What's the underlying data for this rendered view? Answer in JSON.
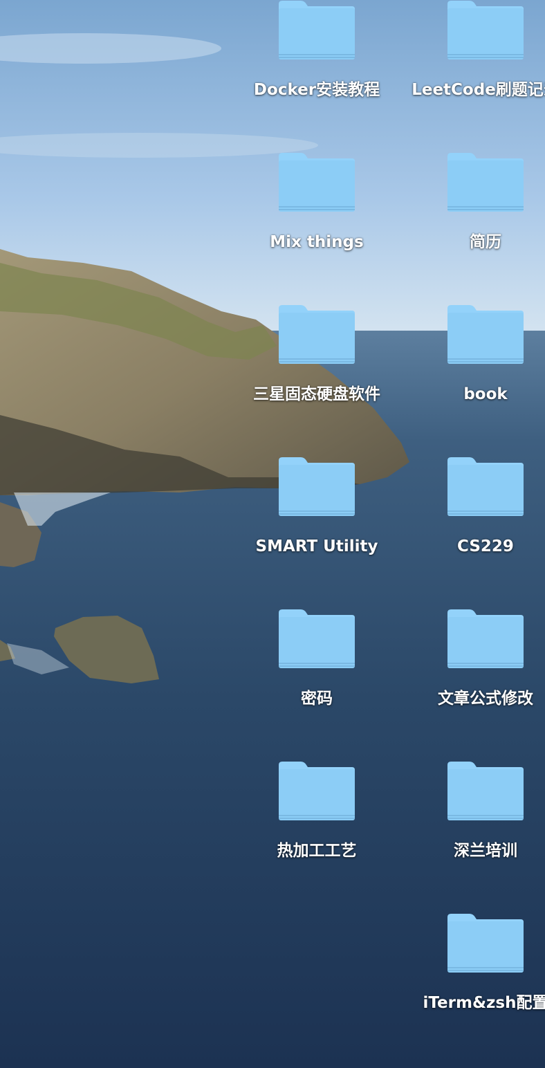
{
  "desktop": {
    "items": [
      {
        "label": "Docker安装教程",
        "icon": "folder-icon"
      },
      {
        "label": "LeetCode刷题记录",
        "icon": "folder-icon"
      },
      {
        "label": "Mix things",
        "icon": "folder-icon"
      },
      {
        "label": "简历",
        "icon": "folder-icon"
      },
      {
        "label": "三星固态硬盘软件",
        "icon": "folder-icon"
      },
      {
        "label": "book",
        "icon": "folder-icon"
      },
      {
        "label": "SMART Utility",
        "icon": "folder-icon"
      },
      {
        "label": "CS229",
        "icon": "folder-icon"
      },
      {
        "label": "密码",
        "icon": "folder-icon"
      },
      {
        "label": "文章公式修改",
        "icon": "folder-icon"
      },
      {
        "label": "热加工工艺",
        "icon": "folder-icon"
      },
      {
        "label": "深兰培训",
        "icon": "folder-icon"
      },
      {
        "label": "iTerm&zsh配置",
        "icon": "folder-icon"
      }
    ]
  },
  "colors": {
    "folder_body": "#8ccdf6",
    "folder_tab": "#9ad6fb",
    "label_text": "#ffffff"
  }
}
